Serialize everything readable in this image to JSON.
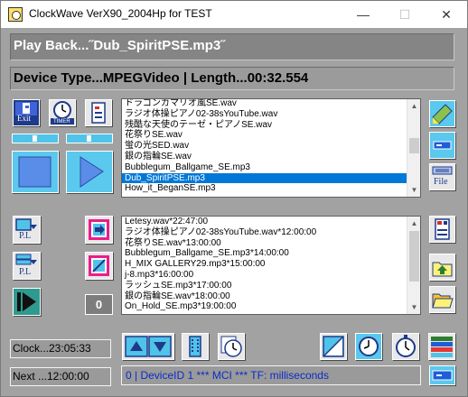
{
  "window": {
    "title": "ClockWave VerX90_2004Hp for TEST",
    "minimize_glyph": "—",
    "maximize_glyph": "☐",
    "close_glyph": "✕"
  },
  "playback": {
    "text": "Play Back...˝Dub_SpiritPSE.mp3˝"
  },
  "device": {
    "text": "Device Type...MPEGVideo  |  Length...00:32.554"
  },
  "buttons": {
    "exit_label": "Exit",
    "timer_label": "TIMER",
    "pl_label": "P.L",
    "pl2_label": "P.L",
    "file_label": "File",
    "counter_value": "0"
  },
  "file_list": {
    "items": [
      "ドラゴンガマリオ風SE.wav",
      "ラジオ体操ピアノ02-38sYouTube.wav",
      "残酷な天使のテーゼ・ピアノSE.wav",
      "花祭りSE.wav",
      "蛍の光SED.wav",
      "銀の指輪SE.wav",
      "Bubblegum_Ballgame_SE.mp3",
      "Dub_SpiritPSE.mp3",
      "How_it_BeganSE.mp3"
    ],
    "selected_index": 7
  },
  "schedule_list": {
    "items": [
      "Letesy.wav*22:47:00",
      "ラジオ体操ピアノ02-38sYouTube.wav*12:00:00",
      "花祭りSE.wav*13:00:00",
      "Bubblegum_Ballgame_SE.mp3*14:00:00",
      "H_MIX GALLERY29.mp3*15:00:00",
      "j-8.mp3*16:00:00",
      "ラッシュSE.mp3*17:00:00",
      "銀の指輪SE.wav*18:00:00",
      "On_Hold_SE.mp3*19:00:00"
    ]
  },
  "clock": {
    "text": "Clock...23:05:33"
  },
  "next": {
    "text": "Next ...12:00:00"
  },
  "mci_status": {
    "text": "0 | DeviceID 1 *** MCI ***  TF: milliseconds"
  },
  "colors": {
    "accent_blue": "#0078d7",
    "bar_gray": "#858585",
    "status_text_blue": "#0a2cc8",
    "play_cyan": "#4fc3e8"
  },
  "icons": {
    "exit": "exit-door-icon",
    "timer": "timer-clock-icon",
    "settings": "panel-settings-icon",
    "stop": "stop-square-icon",
    "play": "play-triangle-icon",
    "edit": "pencil-edit-icon",
    "minus": "minus-bar-icon",
    "file": "keyboard-file-icon",
    "pl_in": "playlist-in-icon",
    "pl_out": "playlist-out-icon",
    "skip": "skip-next-icon",
    "add": "add-to-list-icon",
    "remove": "remove-from-list-icon",
    "upload": "folder-upload-icon",
    "open_folder": "open-folder-icon",
    "scroll_up": "scroll-up-icon",
    "scroll_down": "scroll-down-icon",
    "sort": "sort-icon",
    "schedule": "schedule-clock-icon",
    "chart": "chart-icon",
    "alarm": "alarm-clock-icon",
    "stopwatch": "stopwatch-icon",
    "color_bars": "color-bars-icon"
  }
}
